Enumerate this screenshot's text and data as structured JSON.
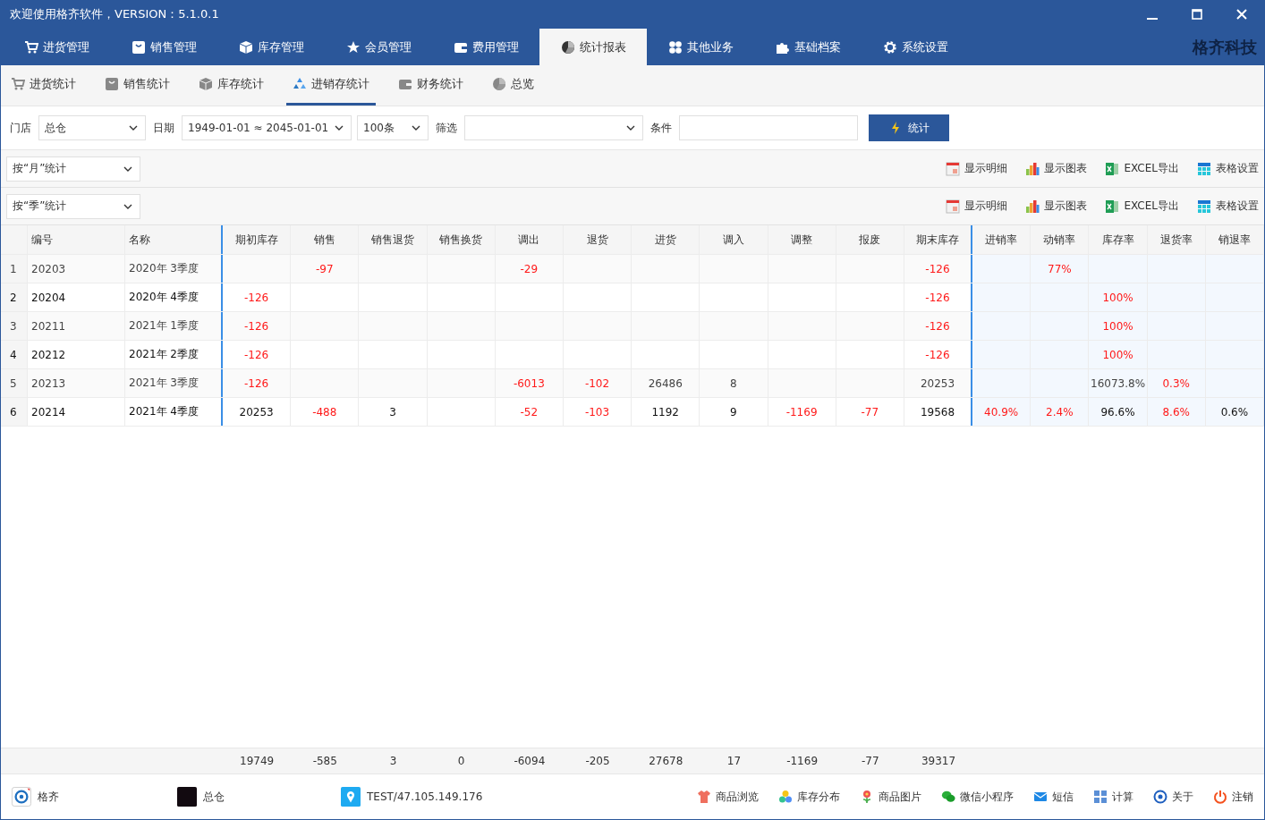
{
  "window": {
    "title": "欢迎使用格齐软件，VERSION：5.1.0.1",
    "brand": "格齐科技"
  },
  "nav_tabs": [
    {
      "label": "进货管理",
      "selected": false
    },
    {
      "label": "销售管理",
      "selected": false
    },
    {
      "label": "库存管理",
      "selected": false
    },
    {
      "label": "会员管理",
      "selected": false
    },
    {
      "label": "费用管理",
      "selected": false
    },
    {
      "label": "统计报表",
      "selected": true
    },
    {
      "label": "其他业务",
      "selected": false
    },
    {
      "label": "基础档案",
      "selected": false
    },
    {
      "label": "系统设置",
      "selected": false
    }
  ],
  "sub_tabs": [
    {
      "label": "进货统计",
      "selected": false
    },
    {
      "label": "销售统计",
      "selected": false
    },
    {
      "label": "库存统计",
      "selected": false
    },
    {
      "label": "进销存统计",
      "selected": true
    },
    {
      "label": "财务统计",
      "selected": false
    },
    {
      "label": "总览",
      "selected": false
    }
  ],
  "filters": {
    "store_label": "门店",
    "store": "总仓",
    "date_label": "日期",
    "date": "1949-01-01 ≈ 2045-01-01",
    "limit": "100条",
    "filter_label": "筛选",
    "condition_label": "条件",
    "submit": "统计"
  },
  "toolbars": [
    {
      "group_by": "按“月”统计",
      "buttons": [
        "显示明细",
        "显示图表",
        "EXCEL导出",
        "表格设置"
      ]
    },
    {
      "group_by": "按“季”统计",
      "buttons": [
        "显示明细",
        "显示图表",
        "EXCEL导出",
        "表格设置"
      ]
    }
  ],
  "table": {
    "columns": [
      "编号",
      "名称",
      "期初库存",
      "销售",
      "销售退货",
      "销售换货",
      "调出",
      "退货",
      "进货",
      "调入",
      "调整",
      "报废",
      "期末库存",
      "进销率",
      "动销率",
      "库存率",
      "退货率",
      "销退率"
    ],
    "rows": [
      {
        "index": "1",
        "cells": [
          "20203",
          "2020年 3季度",
          null,
          {
            "v": "-97",
            "red": true
          },
          null,
          null,
          {
            "v": "-29",
            "red": true
          },
          null,
          null,
          null,
          null,
          null,
          {
            "v": "-126",
            "red": true
          },
          null,
          {
            "v": "77%",
            "red": true
          },
          null,
          null,
          null
        ]
      },
      {
        "index": "2",
        "cells": [
          "20204",
          "2020年 4季度",
          {
            "v": "-126",
            "red": true
          },
          null,
          null,
          null,
          null,
          null,
          null,
          null,
          null,
          null,
          {
            "v": "-126",
            "red": true
          },
          null,
          null,
          {
            "v": "100%",
            "red": true
          },
          null,
          null
        ]
      },
      {
        "index": "3",
        "cells": [
          "20211",
          "2021年 1季度",
          {
            "v": "-126",
            "red": true
          },
          null,
          null,
          null,
          null,
          null,
          null,
          null,
          null,
          null,
          {
            "v": "-126",
            "red": true
          },
          null,
          null,
          {
            "v": "100%",
            "red": true
          },
          null,
          null
        ]
      },
      {
        "index": "4",
        "cells": [
          "20212",
          "2021年 2季度",
          {
            "v": "-126",
            "red": true
          },
          null,
          null,
          null,
          null,
          null,
          null,
          null,
          null,
          null,
          {
            "v": "-126",
            "red": true
          },
          null,
          null,
          {
            "v": "100%",
            "red": true
          },
          null,
          null
        ]
      },
      {
        "index": "5",
        "cells": [
          "20213",
          "2021年 3季度",
          {
            "v": "-126",
            "red": true
          },
          null,
          null,
          null,
          {
            "v": "-6013",
            "red": true
          },
          {
            "v": "-102",
            "red": true
          },
          {
            "v": "26486",
            "red": false
          },
          {
            "v": "8",
            "red": false
          },
          null,
          null,
          {
            "v": "20253",
            "red": false
          },
          null,
          null,
          {
            "v": "16073.8%",
            "red": false
          },
          {
            "v": "0.3%",
            "red": true
          },
          null
        ]
      },
      {
        "index": "6",
        "cells": [
          "20214",
          "2021年 4季度",
          {
            "v": "20253",
            "red": false
          },
          {
            "v": "-488",
            "red": true
          },
          {
            "v": "3",
            "red": false
          },
          null,
          {
            "v": "-52",
            "red": true
          },
          {
            "v": "-103",
            "red": true
          },
          {
            "v": "1192",
            "red": false
          },
          {
            "v": "9",
            "red": false
          },
          {
            "v": "-1169",
            "red": true
          },
          {
            "v": "-77",
            "red": true
          },
          {
            "v": "19568",
            "red": false
          },
          {
            "v": "40.9%",
            "red": true
          },
          {
            "v": "2.4%",
            "red": true
          },
          {
            "v": "96.6%",
            "red": false
          },
          {
            "v": "8.6%",
            "red": true
          },
          {
            "v": "0.6%",
            "red": false
          }
        ]
      }
    ],
    "totals": [
      "19749",
      "-585",
      "3",
      "0",
      "-6094",
      "-205",
      "27678",
      "17",
      "-1169",
      "-77",
      "39317"
    ]
  },
  "status_bar": {
    "user": "格齐",
    "store": "总仓",
    "server": "TEST/47.105.149.176",
    "links": [
      "商品浏览",
      "库存分布",
      "商品图片",
      "微信小程序",
      "短信",
      "计算",
      "关于",
      "注销"
    ]
  }
}
